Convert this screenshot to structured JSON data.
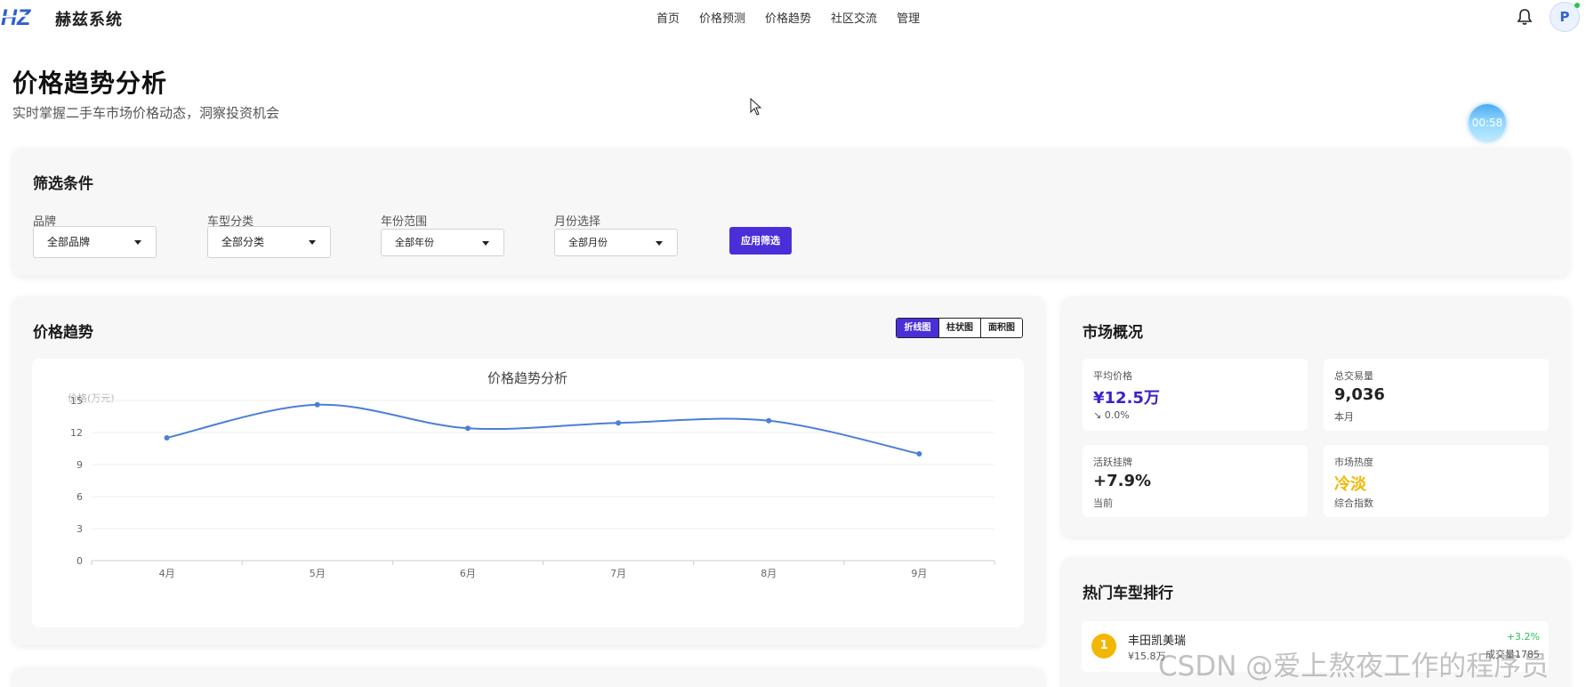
{
  "brand": {
    "name": "赫兹系统",
    "logo_text": "HZ"
  },
  "nav": {
    "items": [
      "首页",
      "价格预测",
      "价格趋势",
      "社区交流",
      "管理"
    ]
  },
  "user": {
    "avatar_letter": "P"
  },
  "page": {
    "title": "价格趋势分析",
    "subtitle": "实时掌握二手车市场价格动态，洞察投资机会",
    "timer": "00:58"
  },
  "filters": {
    "title": "筛选条件",
    "fields": [
      {
        "label": "品牌",
        "value": "全部品牌"
      },
      {
        "label": "车型分类",
        "value": "全部分类"
      },
      {
        "label": "年份范围",
        "value": "全部年份"
      },
      {
        "label": "月份选择",
        "value": "全部月份"
      }
    ],
    "apply_label": "应用筛选"
  },
  "trend": {
    "title": "价格趋势",
    "chart_types": [
      "折线图",
      "柱状图",
      "面积图"
    ],
    "active_type": "折线图"
  },
  "chart_data": {
    "type": "line",
    "title": "价格趋势分析",
    "ylabel": "价格(万元)",
    "xlabel": "",
    "categories": [
      "4月",
      "5月",
      "6月",
      "7月",
      "8月",
      "9月"
    ],
    "values": [
      11.5,
      14.6,
      12.4,
      12.9,
      13.1,
      10.0
    ],
    "ylim": [
      0,
      15
    ],
    "yticks": [
      0,
      3,
      6,
      9,
      12,
      15
    ],
    "smooth": true,
    "grid": true,
    "color": "#4a7fd9"
  },
  "overview": {
    "title": "市场概况",
    "stats": [
      {
        "label": "平均价格",
        "value": "¥12.5万",
        "sub": "↘ 0.0%",
        "color": "#3b22c9"
      },
      {
        "label": "总交易量",
        "value": "9,036",
        "sub": "本月",
        "color": "#222222"
      },
      {
        "label": "活跃挂牌",
        "value": "+7.9%",
        "sub": "当前",
        "color": "#222222"
      },
      {
        "label": "市场热度",
        "value": "冷淡",
        "sub": "综合指数",
        "color": "#f2b705"
      }
    ]
  },
  "ranking": {
    "title": "热门车型排行",
    "items": [
      {
        "rank": "1",
        "name": "丰田凯美瑞",
        "price": "¥15.8万",
        "change": "+3.2%",
        "count": "成交量1785"
      }
    ]
  },
  "watermark": "CSDN @爱上熬夜工作的程序员"
}
